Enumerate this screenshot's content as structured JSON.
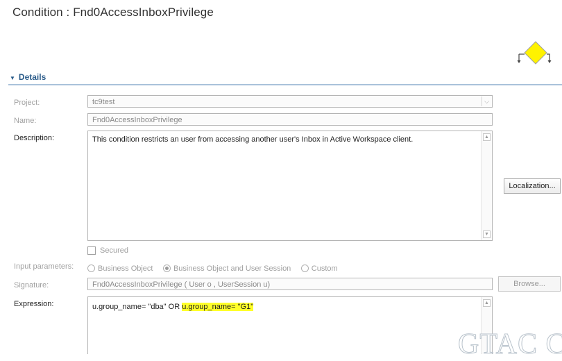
{
  "page": {
    "title": "Condition : Fnd0AccessInboxPrivilege"
  },
  "details": {
    "section_title": "Details",
    "project": {
      "label": "Project:",
      "value": "tc9test"
    },
    "name": {
      "label": "Name:",
      "value": "Fnd0AccessInboxPrivilege"
    },
    "description": {
      "label": "Description:",
      "value": "This condition restricts an user from accessing another user's Inbox in Active Workspace client."
    },
    "localization_button": "Localization...",
    "secured_label": "Secured",
    "input_parameters": {
      "label": "Input parameters:",
      "options": [
        "Business Object",
        "Business Object and User Session",
        "Custom"
      ],
      "selected": "Business Object and User Session"
    },
    "signature": {
      "label": "Signature:",
      "value": "Fnd0AccessInboxPrivilege ( User o , UserSession u)"
    },
    "browse_button": "Browse...",
    "expression": {
      "label": "Expression:",
      "part1": "u.group_name= \"dba\" OR ",
      "part2_highlighted": "u.group_name= \"G1\""
    }
  },
  "watermark": "GTAC C",
  "colors": {
    "section_header": "#2b5c8a",
    "highlight": "#ffff2a",
    "condition_icon": "#fff200"
  },
  "icons": {
    "condition": "condition-diamond-icon",
    "expand": "expand-triangle-icon",
    "dropdown": "chevron-down-icon"
  }
}
